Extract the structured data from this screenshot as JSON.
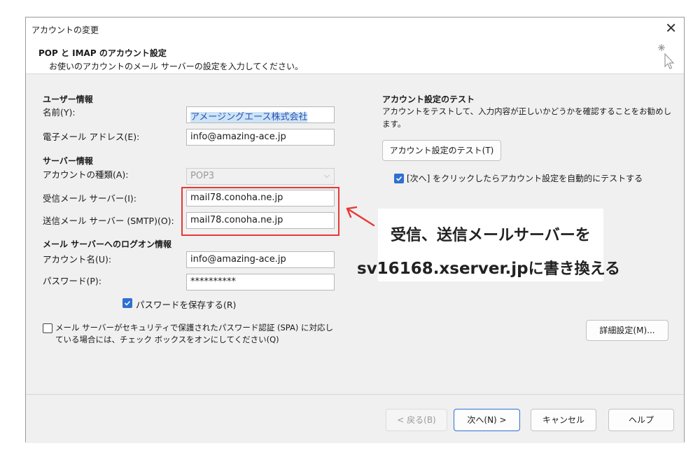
{
  "window": {
    "title": "アカウントの変更",
    "close_glyph": "✕"
  },
  "header": {
    "title": "POP と IMAP のアカウント設定",
    "subtitle": "お使いのアカウントのメール サーバーの設定を入力してください。"
  },
  "user_info": {
    "heading": "ユーザー情報",
    "name_label": "名前(Y):",
    "name_value": "アメージングエース株式会社",
    "email_label": "電子メール アドレス(E):",
    "email_value": "info@amazing-ace.jp"
  },
  "server_info": {
    "heading": "サーバー情報",
    "account_type_label": "アカウントの種類(A):",
    "account_type_value": "POP3",
    "incoming_label": "受信メール サーバー(I):",
    "incoming_value": "mail78.conoha.ne.jp",
    "outgoing_label": "送信メール サーバー (SMTP)(O):",
    "outgoing_value": "mail78.conoha.ne.jp"
  },
  "logon_info": {
    "heading": "メール サーバーへのログオン情報",
    "account_name_label": "アカウント名(U):",
    "account_name_value": "info@amazing-ace.jp",
    "password_label": "パスワード(P):",
    "password_value": "**********",
    "save_password_label": "パスワードを保存する(R)",
    "spa_line1": "メール サーバーがセキュリティで保護されたパスワード認証 (SPA) に対応し",
    "spa_line2": "ている場合には、チェック ボックスをオンにしてください(Q)"
  },
  "test": {
    "heading": "アカウント設定のテスト",
    "desc_line1": "アカウントをテストして、入力内容が正しいかどうかを確認することをお勧めし",
    "desc_line2": "ます。",
    "button_label": "アカウント設定のテスト(T)",
    "auto_test_label": "[次へ] をクリックしたらアカウント設定を自動的にテストする"
  },
  "advanced_button": "詳細設定(M)...",
  "footer": {
    "back": "< 戻る(B)",
    "next": "次へ(N) >",
    "cancel": "キャンセル",
    "help": "ヘルプ"
  },
  "annotation": {
    "line1": "受信、送信メールサーバーを",
    "line2_host": "sv16168.xserver.jp",
    "line2_rest": "に書き換える",
    "color": "#e53935"
  }
}
